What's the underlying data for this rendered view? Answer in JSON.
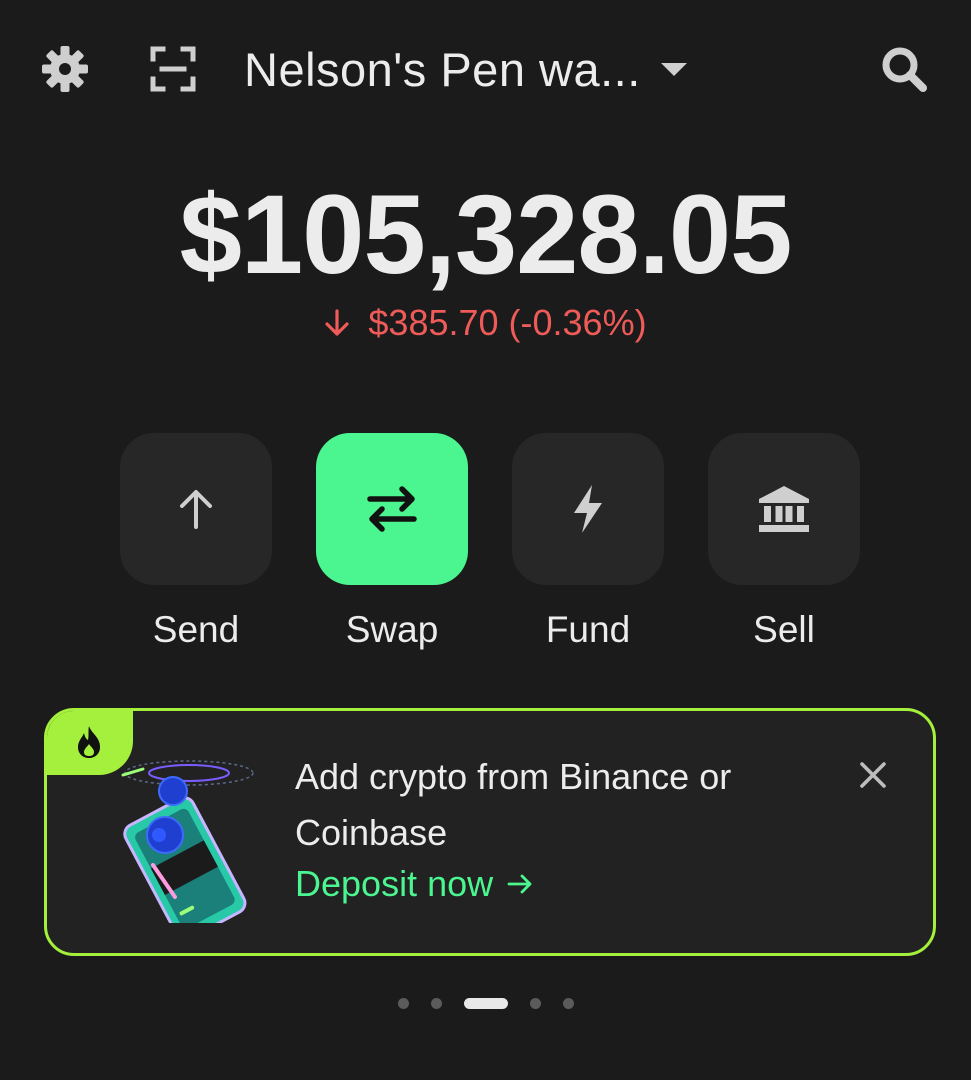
{
  "header": {
    "settings_icon": "gear-icon",
    "scan_icon": "scan-icon",
    "wallet_name": "Nelson's Pen wa...",
    "search_icon": "search-icon"
  },
  "balance": {
    "amount": "$105,328.05",
    "change_text": "$385.70 (-0.36%)",
    "change_direction": "down",
    "change_color": "#ee5b59"
  },
  "actions": [
    {
      "label": "Send",
      "icon": "arrow-up-icon"
    },
    {
      "label": "Swap",
      "icon": "swap-icon",
      "highlighted": true
    },
    {
      "label": "Fund",
      "icon": "lightning-icon"
    },
    {
      "label": "Sell",
      "icon": "bank-icon"
    }
  ],
  "promo": {
    "title": "Add crypto from Binance or Coinbase",
    "link_label": "Deposit now",
    "badge_icon": "flame-icon",
    "accent_color": "#a4f03c"
  },
  "pager": {
    "total": 5,
    "active_index": 2
  },
  "colors": {
    "background": "#1b1b1b",
    "primary_green": "#4bf58f",
    "negative_red": "#ee5b59"
  }
}
